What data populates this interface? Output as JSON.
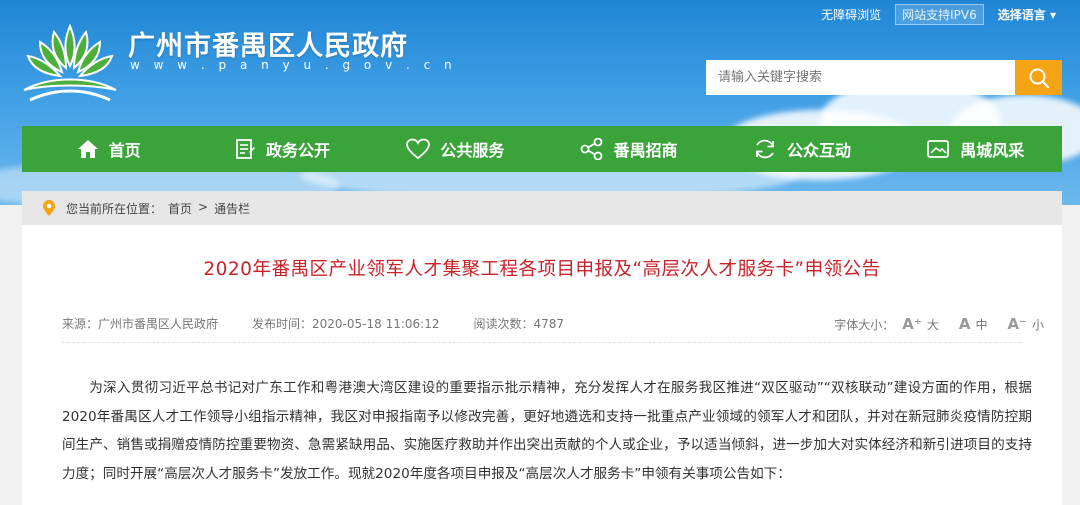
{
  "header": {
    "accessibility_label": "无障碍浏览",
    "ipv6_label": "网站支持IPV6",
    "language_label": "选择语言",
    "site_title": "广州市番禺区人民政府",
    "site_url": "w w w . p a n y u . g o v . c n"
  },
  "search": {
    "placeholder": "请输入关键字搜索"
  },
  "nav": {
    "items": [
      {
        "label": "首页",
        "icon": "home-icon"
      },
      {
        "label": "政务公开",
        "icon": "document-icon"
      },
      {
        "label": "公共服务",
        "icon": "heart-icon"
      },
      {
        "label": "番禺招商",
        "icon": "share-icon"
      },
      {
        "label": "公众互动",
        "icon": "refresh-icon"
      },
      {
        "label": "禺城风采",
        "icon": "picture-icon"
      }
    ]
  },
  "breadcrumb": {
    "prefix": "您当前所在位置：",
    "home": "首页",
    "separator": ">",
    "current": "通告栏"
  },
  "article": {
    "title": "2020年番禺区产业领军人才集聚工程各项目申报及“高层次人才服务卡”申领公告",
    "source": "来源：广州市番禺区人民政府",
    "published": "发布时间：2020-05-18 11:06:12",
    "views": "阅读次数：4787",
    "font_size_label": "字体大小：",
    "font_large": "大",
    "font_medium": "中",
    "font_small": "小",
    "body": "为深入贯彻习近平总书记对广东工作和粤港澳大湾区建设的重要指示批示精神，充分发挥人才在服务我区推进“双区驱动”“双核联动”建设方面的作用，根据2020年番禺区人才工作领导小组指示精神，我区对申报指南予以修改完善，更好地遴选和支持一批重点产业领域的领军人才和团队，并对在新冠肺炎疫情防控期间生产、销售或捐赠疫情防控重要物资、急需紧缺用品、实施医疗救助并作出突出贡献的个人或企业，予以适当倾斜，进一步加大对实体经济和新引进项目的支持力度；同时开展“高层次人才服务卡”发放工作。现就2020年度各项目申报及“高层次人才服务卡”申领有关事项公告如下："
  },
  "colors": {
    "nav_green": "#3aa33a",
    "title_red": "#c8232b",
    "search_orange": "#f5a416",
    "sky_blue": "#1f86d6"
  }
}
